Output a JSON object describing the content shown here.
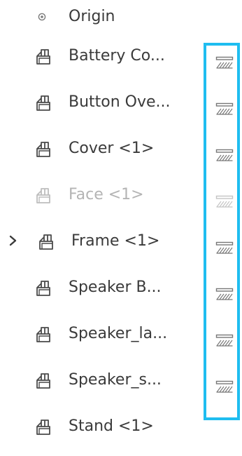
{
  "browser": {
    "origin": {
      "label": "Origin",
      "icon": "origin-icon"
    },
    "items": [
      {
        "label": "Battery Co...",
        "icon": "component-icon",
        "dim": false,
        "expandable": false,
        "material_icon": "material-icon"
      },
      {
        "label": "Button Ove...",
        "icon": "component-icon",
        "dim": false,
        "expandable": false,
        "material_icon": "material-icon"
      },
      {
        "label": "Cover <1>",
        "icon": "component-icon",
        "dim": false,
        "expandable": false,
        "material_icon": "material-icon"
      },
      {
        "label": "Face <1>",
        "icon": "component-icon",
        "dim": true,
        "expandable": false,
        "material_icon": "material-icon"
      },
      {
        "label": "Frame <1>",
        "icon": "component-icon",
        "dim": false,
        "expandable": true,
        "material_icon": "material-icon"
      },
      {
        "label": "Speaker B...",
        "icon": "component-icon",
        "dim": false,
        "expandable": false,
        "material_icon": "material-icon"
      },
      {
        "label": "Speaker_la...",
        "icon": "component-icon",
        "dim": false,
        "expandable": false,
        "material_icon": "material-icon"
      },
      {
        "label": "Speaker_s...",
        "icon": "component-icon",
        "dim": false,
        "expandable": false,
        "material_icon": "material-icon"
      },
      {
        "label": "Stand <1>",
        "icon": "component-icon",
        "dim": false,
        "expandable": false,
        "material_icon": null
      }
    ]
  },
  "colors": {
    "highlight": "#1fbdf0",
    "text": "#3a3a3a",
    "dim_text": "#b4b4b4"
  }
}
